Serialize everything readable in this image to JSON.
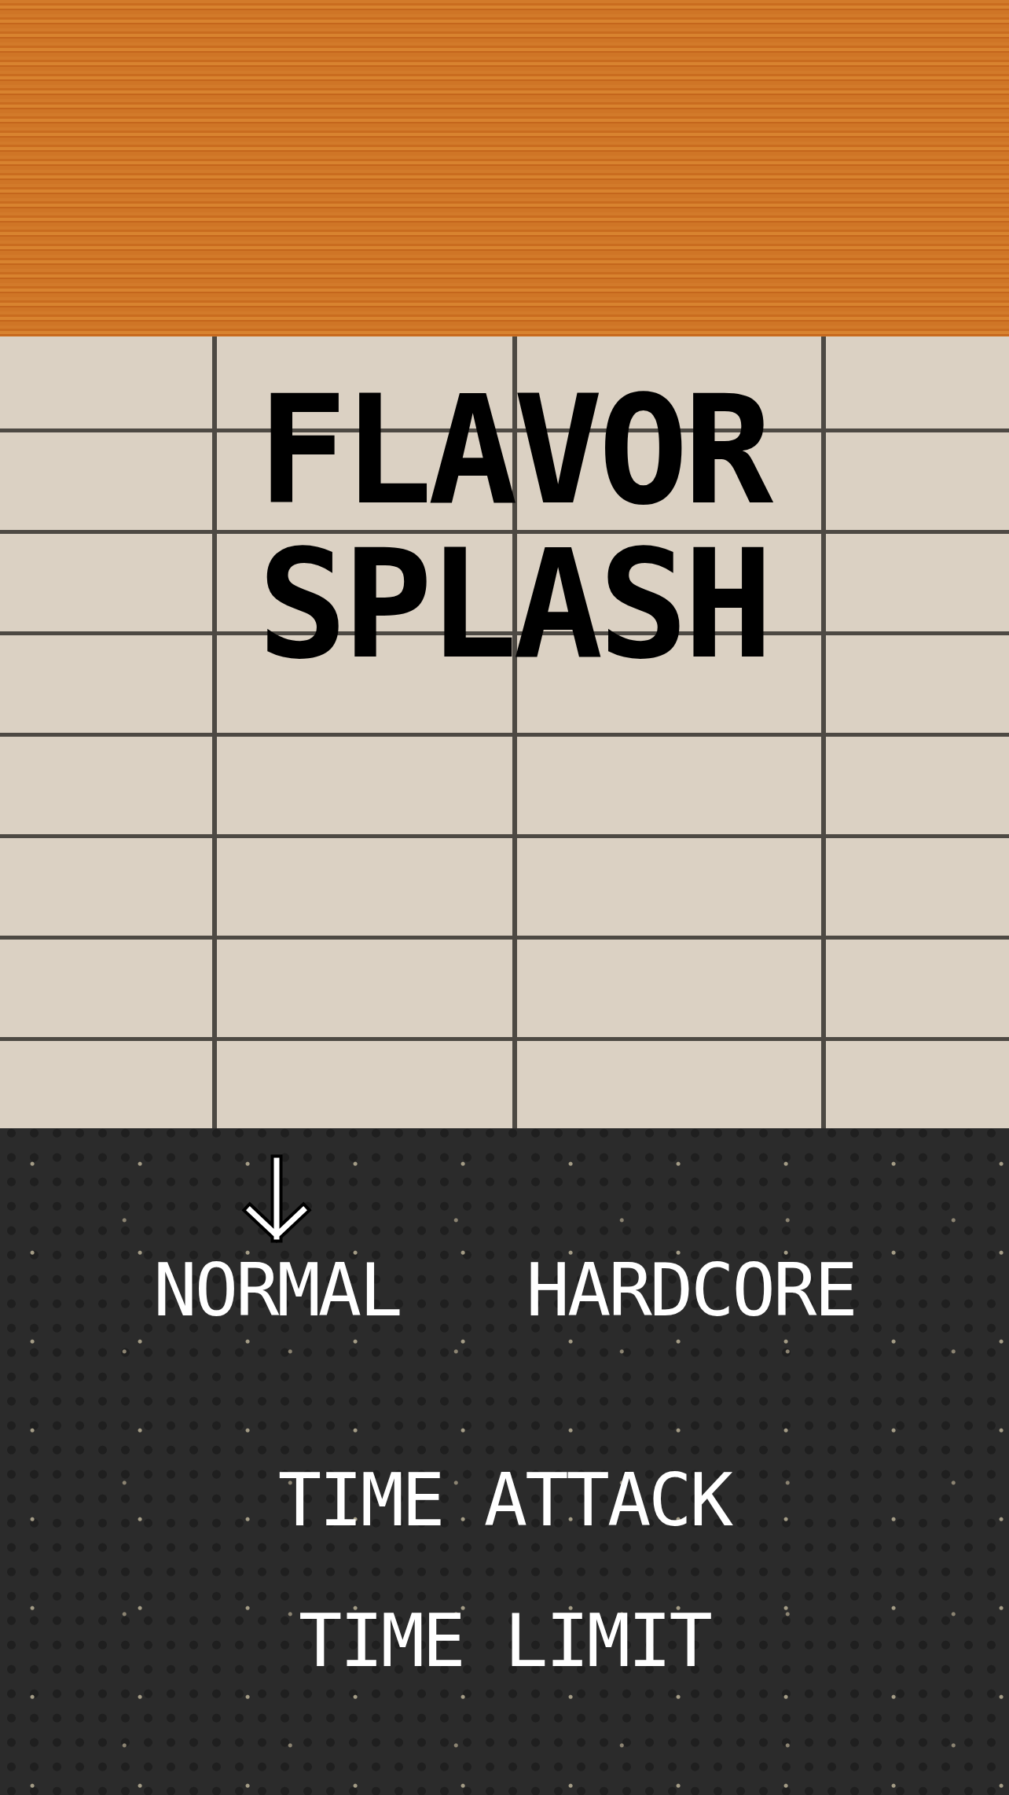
{
  "title": "FLAVOR SPLASH",
  "menu": {
    "rows": [
      {
        "options": [
          {
            "label": "NORMAL",
            "selected": true
          },
          {
            "label": "HARDCORE",
            "selected": false
          }
        ]
      },
      {
        "options": [
          {
            "label": "TIME ATTACK",
            "selected": false
          }
        ]
      },
      {
        "options": [
          {
            "label": "TIME LIMIT",
            "selected": false
          }
        ]
      }
    ]
  }
}
